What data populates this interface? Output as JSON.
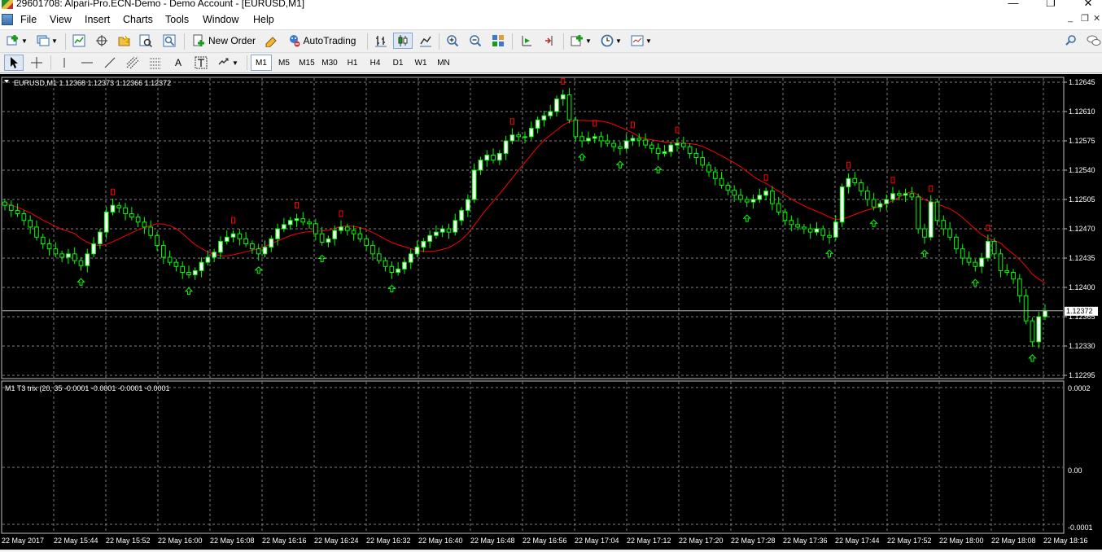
{
  "window": {
    "title": "29601708: Alpari-Pro.ECN-Demo - Demo Account - [EURUSD,M1]",
    "minimize": "—",
    "maximize": "❐",
    "close": "✕"
  },
  "menu": {
    "items": [
      "File",
      "View",
      "Insert",
      "Charts",
      "Tools",
      "Window",
      "Help"
    ],
    "mdi_minimize": "_",
    "mdi_restore": "❐",
    "mdi_close": "✕"
  },
  "toolbar": {
    "new_order": "New Order",
    "autotrading": "AutoTrading",
    "icons": [
      "new-chart-icon",
      "profiles-icon",
      "market-watch-icon",
      "data-window-icon",
      "navigator-icon",
      "terminal-icon",
      "strategy-tester-icon",
      "new-order-icon",
      "metaeditor-icon",
      "autotrading-icon",
      "bar-chart-icon",
      "candlesticks-icon",
      "line-chart-icon",
      "zoom-in-icon",
      "zoom-out-icon",
      "tile-windows-icon",
      "autoscroll-icon",
      "chart-shift-icon",
      "indicators-icon",
      "periods-icon",
      "templates-icon",
      "search-icon",
      "chat-icon"
    ]
  },
  "timeframes": [
    "M1",
    "M5",
    "M15",
    "M30",
    "H1",
    "H4",
    "D1",
    "W1",
    "MN"
  ],
  "selected_timeframe": "M1",
  "chart": {
    "header": "EURUSD,M1  1.12368 1.12373 1.12366 1.12372",
    "symbol": "EURUSD",
    "period": "M1",
    "ohlc": {
      "open": 1.12368,
      "high": 1.12373,
      "low": 1.12366,
      "close": 1.12372
    },
    "current_price_label": "1.12372",
    "current_price": 1.12372,
    "price_ticks": [
      "1.12645",
      "1.12610",
      "1.12575",
      "1.12540",
      "1.12505",
      "1.12470",
      "1.12435",
      "1.12400",
      "1.12365",
      "1.12330",
      "1.12295"
    ],
    "price_range": [
      1.12295,
      1.12645
    ],
    "time_labels": [
      "22 May 2017",
      "22 May 15:44",
      "22 May 15:52",
      "22 May 16:00",
      "22 May 16:08",
      "22 May 16:16",
      "22 May 16:24",
      "22 May 16:32",
      "22 May 16:40",
      "22 May 16:48",
      "22 May 16:56",
      "22 May 17:04",
      "22 May 17:12",
      "22 May 17:20",
      "22 May 17:28",
      "22 May 17:36",
      "22 May 17:44",
      "22 May 17:52",
      "22 May 18:00",
      "22 May 18:08",
      "22 May 18:16"
    ],
    "colors": {
      "background": "#000000",
      "grid": "#7f7f7f",
      "bull": "#00ff00",
      "bear": "#00ff00",
      "bear_body": "#000000",
      "bull_body": "#ffffff",
      "ma": "#ff0000",
      "arrow_up": "#00ff00",
      "arrow_down": "#ff0000"
    }
  },
  "indicator": {
    "header": "M1 T3 trix (20, 35 -0.0001 -0.0001 -0.0001 -0.0001",
    "ticks": [
      "0.0002",
      "0.00",
      "-0.0001"
    ]
  },
  "chart_data": {
    "type": "candlestick",
    "title": "EURUSD,M1",
    "xlabel": "",
    "ylabel": "",
    "ylim": [
      1.12295,
      1.12645
    ],
    "x_tick_labels": [
      "22 May 2017",
      "22 May 15:44",
      "22 May 15:52",
      "22 May 16:00",
      "22 May 16:08",
      "22 May 16:16",
      "22 May 16:24",
      "22 May 16:32",
      "22 May 16:40",
      "22 May 16:48",
      "22 May 16:56",
      "22 May 17:04",
      "22 May 17:12",
      "22 May 17:20",
      "22 May 17:28",
      "22 May 17:36",
      "22 May 17:44",
      "22 May 17:52",
      "22 May 18:00",
      "22 May 18:08",
      "22 May 18:16"
    ],
    "closes": [
      1.12498,
      1.12492,
      1.12488,
      1.1248,
      1.12472,
      1.1246,
      1.12452,
      1.12446,
      1.1244,
      1.12436,
      1.1244,
      1.12432,
      1.12426,
      1.1244,
      1.12452,
      1.12466,
      1.1249,
      1.12498,
      1.12495,
      1.12488,
      1.12484,
      1.12478,
      1.12472,
      1.12462,
      1.1245,
      1.12436,
      1.1243,
      1.12425,
      1.12418,
      1.12415,
      1.1242,
      1.1243,
      1.12436,
      1.12442,
      1.12455,
      1.1246,
      1.12464,
      1.12458,
      1.12452,
      1.12446,
      1.1244,
      1.12448,
      1.12458,
      1.1247,
      1.12475,
      1.1248,
      1.12482,
      1.12478,
      1.12476,
      1.12464,
      1.12454,
      1.12458,
      1.12468,
      1.12472,
      1.12468,
      1.12464,
      1.12458,
      1.1245,
      1.1244,
      1.12432,
      1.12425,
      1.12418,
      1.12422,
      1.1243,
      1.1244,
      1.12448,
      1.12455,
      1.12462,
      1.12466,
      1.1247,
      1.12466,
      1.1248,
      1.12492,
      1.12505,
      1.1254,
      1.12552,
      1.12558,
      1.12552,
      1.1256,
      1.12575,
      1.12582,
      1.1258,
      1.1258,
      1.1259,
      1.126,
      1.12605,
      1.1261,
      1.12625,
      1.1263,
      1.126,
      1.1258,
      1.12575,
      1.12578,
      1.1258,
      1.12575,
      1.12572,
      1.12568,
      1.12566,
      1.12575,
      1.12578,
      1.12576,
      1.1257,
      1.12566,
      1.1256,
      1.12562,
      1.1257,
      1.12572,
      1.12568,
      1.1256,
      1.12555,
      1.12546,
      1.12538,
      1.1253,
      1.12522,
      1.12516,
      1.1251,
      1.12505,
      1.12502,
      1.12505,
      1.1251,
      1.12515,
      1.125,
      1.1249,
      1.1248,
      1.12475,
      1.12472,
      1.1247,
      1.12466,
      1.1247,
      1.12462,
      1.1246,
      1.12478,
      1.1252,
      1.1253,
      1.12525,
      1.12515,
      1.12505,
      1.12496,
      1.125,
      1.12505,
      1.12512,
      1.1251,
      1.12512,
      1.12508,
      1.1247,
      1.1246,
      1.12502,
      1.1248,
      1.1247,
      1.1246,
      1.12446,
      1.12435,
      1.1243,
      1.12425,
      1.12435,
      1.12455,
      1.1244,
      1.1242,
      1.12418,
      1.1241,
      1.1239,
      1.1236,
      1.12335,
      1.12365,
      1.12372
    ]
  }
}
